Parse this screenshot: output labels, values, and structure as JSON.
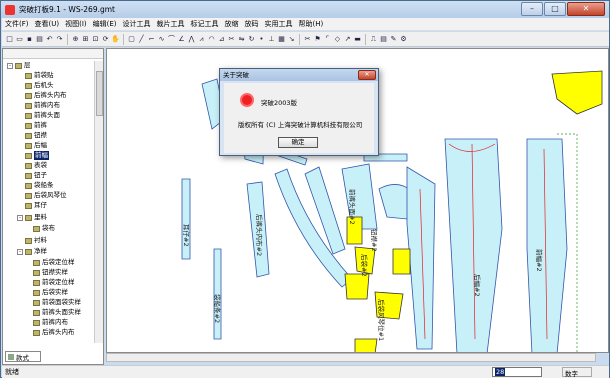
{
  "window": {
    "title": "突破打板9.1 - WS-269.gmt"
  },
  "menu": [
    "文件(F)",
    "查看(U)",
    "视图(I)",
    "编辑(E)",
    "设计工具",
    "裁片工具",
    "标记工具",
    "放缩",
    "放码",
    "实用工具",
    "帮助(H)"
  ],
  "tree": {
    "header": "层",
    "items": [
      "前袋贴",
      "后机头",
      "后裤头内布",
      "前裤内布",
      "前裤头面",
      "前裤",
      "钮襟",
      "后幅",
      "前幅",
      "表袋",
      "钮子",
      "袋船条",
      "后袋风琴位",
      "耳仔"
    ],
    "selected_index": 8,
    "group2": "里料",
    "group2_items": [
      "袋布"
    ],
    "group3": "衬料",
    "group4": "净样",
    "group4_items": [
      "后袋定位样",
      "钮襟实样",
      "前袋定位样",
      "后袋实样",
      "前袋面袋实样",
      "前裤头面实样",
      "前裤内布",
      "后裤头内布"
    ],
    "tab": "款式"
  },
  "canvas_labels": {
    "front_panel": "前幅#2",
    "back_panel": "后幅#2",
    "left_strip1": "耳仔#2",
    "left_strip2": "袋船条#2",
    "curved_band1": "后裤头内布#2",
    "curved_band2": "前裤头面#2",
    "small_label1": "后袋#2",
    "small_label2": "钮襟#2",
    "small_label3": "后袋风琴位#1"
  },
  "dialog": {
    "title": "关于突破",
    "version": "突破2003版",
    "copyright": "版权所有 (C) 上海突破计算机科技有限公司",
    "ok": "确定"
  },
  "status": {
    "text": "就绪",
    "zoom": "28",
    "field": "数字"
  },
  "colors": {
    "piece_fill": "#c8f0f8",
    "piece_stroke": "#3355aa",
    "yellow_fill": "#ffff00",
    "red_line": "#e02020"
  }
}
